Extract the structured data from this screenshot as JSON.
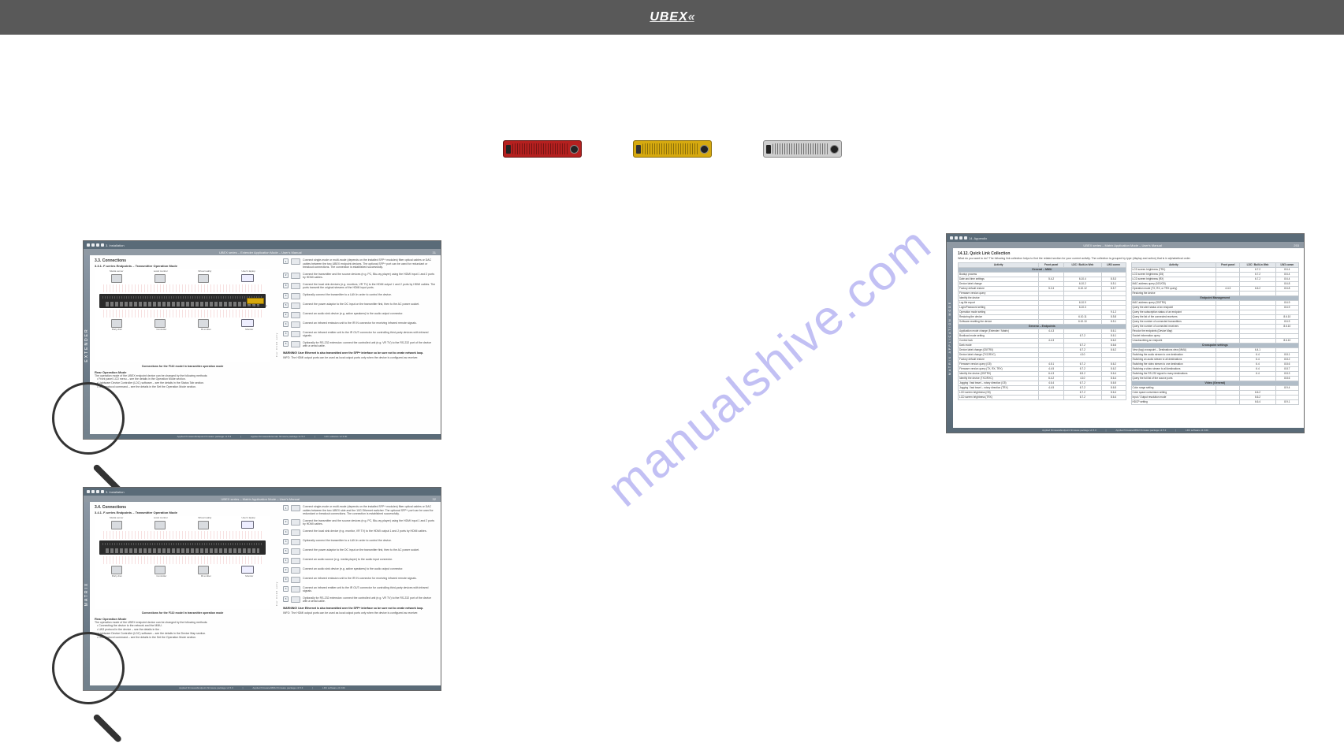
{
  "brand": "UBEX",
  "watermark": "manualshive.com",
  "devices": [
    {
      "name": "device-red",
      "color": "red"
    },
    {
      "name": "device-yellow",
      "color": "yellow"
    },
    {
      "name": "device-silver",
      "color": "silver"
    }
  ],
  "page1": {
    "toolbar_crumb": "3. Installation",
    "header_center": "UBEX series – Extender Application Mode – User's Manual",
    "header_right": "31",
    "sidetab": "EXTENDER",
    "h1": "3.3. Connections",
    "h2": "3.3.1. F-series Endpoints – Transmitter Operation Mode",
    "diag_top": [
      "Media server",
      "Local monitor",
      "Virtual reality",
      "User's laptop"
    ],
    "diag_bottom": [
      "Party disc",
      "Controller",
      "IR emitter",
      "Monitor"
    ],
    "caption": "Connections for the F110 model in transmitter operation mode",
    "sub": "Rear Operation Mode",
    "sub2": "The operation mode of the UBEX endpoint device can be changed by the following methods:",
    "li1": "Front panel LCD menu – see the details in the Operation Mode section.",
    "li2": "Lightware Device Controller (LDC) software – see the details in the Status Tab section.",
    "li3": "LW3 protocol command – see the details in the Set the Operation Mode section.",
    "warn": "WARNING! User Ethernet is also transmitted over the SFP+ interface so be sure not to create network loop.",
    "info": "INFO: The HDMI output ports can be used as local output ports only when the device is configured as receiver.",
    "right_caption": "For F110 only",
    "right_caption2": "For all F-series",
    "steps": [
      "Connect single-mode or multi-mode (depends on the installed SFP+ modules) fiber optical cables or DAC cables between the two UBEX endpoint devices. The optional SFP+ port can be used for redundant or breakout connections. The connection is established successfully.",
      "Connect the transmitter and the source devices (e.g. PC, Blu-ray player) using the HDMI input 1 and 2 ports by HDMI cables.",
      "Connect the local sink devices (e.g. monitors, VR TV) to the HDMI output 1 and 2 ports by HDMI cables. The ports transmit the original streams of the HDMI input ports.",
      "Optionally connect the transmitter to a LAN in order to control the device.",
      "Connect the power adaptor to the DC input on the transmitter first, then to the AC power socket.",
      "",
      "Connect an audio sink device (e.g. active speakers) to the audio output connector.",
      "Connect an infrared emission unit to the IR IN connector for receiving infrared remote signals.",
      "Connect an infrared emitter unit to the IR OUT connector for controlling third-party devices with infrared signals.",
      "Optionally for RS-232 extension: connect the controlled unit (e.g. VR TV) to the RS-232 port of the device with a serial cable."
    ],
    "footer_left": "Applied firmware/Endpoint firmware package v1.5.3",
    "footer_mid": "Applied firmware/Extender firmware package v1.5.3",
    "footer_right": "LDC software v2.3.0b"
  },
  "page2": {
    "toolbar_crumb": "3. Installation",
    "header_center": "UBEX series – Matrix Application Mode – User's Manual",
    "header_right": "32",
    "sidetab": "MATRIX",
    "h1": "3.4. Connections",
    "h2": "3.4.1. F-series Endpoints – Transmitter Operation Mode",
    "diag_top": [
      "Media server",
      "Local monitor",
      "Virtual reality",
      "User's laptop"
    ],
    "diag_bottom": [
      "Party disc",
      "Controller",
      "IR emitter",
      "Monitor"
    ],
    "caption": "Connections for the F110 model in transmitter operation mode",
    "sub": "Rear Operation Mode",
    "sub2": "The operation mode of the UBEX endpoint device can be changed by the following methods:",
    "li1": "Connecting the device to the network and the MMU.",
    "li2": "LW3 protocol in the device – see the details in the .",
    "li3": "Lightware Device Controller (LDC) software – see the details in the Device Map section.",
    "li4": "LW3 protocol command – see the details in the Set the Operation Mode section.",
    "warn": "WARNING! User Ethernet is also transmitted over the SFP+ interface so be sure not to create network loop.",
    "info": "INFO: The HDMI output ports can be used as local output ports only when the device is configured as receiver.",
    "right_caption": "For F110 only",
    "right_caption2": "For all F-series",
    "steps": [
      "Connect single-mode or multi-mode (depends on the installed SFP+ modules) fiber optical cables or DAC cables between the two UBEX side and the 10G Ethernet switcher. The optional SFP+ port can be used for redundant or breakout connections. The connection is established successfully.",
      "Connect the transmitter and the source devices (e.g. PC, Blu-ray player) using the HDMI input 1 and 2 ports by HDMI cables.",
      "Connect the local sink device (e.g. monitor, VR TV) to the HDMI output 1 and 2 ports by HDMI cables.",
      "Optionally connect the transmitter to a LAN in order to control the device.",
      "Connect the power adaptor to the DC input on the transmitter first, then to the AC power socket.",
      "Connect an audio source (e.g. media player) to the audio input connector.",
      "Connect an audio sink device (e.g. active speakers) to the audio output connector.",
      "Connect an infrared emission unit to the IR IN connector for receiving infrared remote signals.",
      "Connect an infrared emitter unit to the IR OUT connector for controlling third-party devices with infrared signals.",
      "Optionally for RS-232 extension: connect the controlled unit (e.g. VR TV) to the RS-232 port of the device with a serial cable."
    ],
    "footer_left": "Applied firmware/Endpoint firmware package v1.5.3",
    "footer_mid": "Applied firmware/MMU firmware package v1.5.3",
    "footer_right": "LDC software v2.3.0b"
  },
  "page3": {
    "toolbar_crumb": "14. Appendix",
    "header_center": "UBEX series – Matrix Application Mode – User's Manual",
    "header_right": "253",
    "sidetab": "MATRIX APPLICATION MODE",
    "h1": "14.12. Quick Link Collection",
    "intro": "What do you want to do? The following link collection helps to find the related section for your current activity. The collection is grouped by type (display and action) that is in alphabetical order.",
    "left_headers": [
      "Activity",
      "Front panel",
      "LDC / Built-in Web",
      "LW3 comm"
    ],
    "right_headers": [
      "Activity",
      "Front panel",
      "LDC / Built-in Web",
      "LW3 comm"
    ],
    "left_group1": "General – MMU",
    "left_group1_rows": [
      [
        "Bootup process",
        "",
        "",
        ""
      ],
      [
        "Date and time settings",
        "5.4.2",
        "6.10.4",
        "8.5.3"
      ],
      [
        "Device label change",
        "",
        "6.10.2",
        "8.5.1"
      ],
      [
        "Factory default restore",
        "5.2.4",
        "6.10.12",
        "8.5.7"
      ],
      [
        "Firmware version query",
        "",
        "",
        ""
      ],
      [
        "Identify the device",
        "",
        "",
        ""
      ],
      [
        "Log file export",
        "",
        "6.10.9",
        ""
      ],
      [
        "Login/Password setting",
        "",
        "6.10.3",
        ""
      ],
      [
        "Operation mode setting",
        "",
        "",
        "9.1.2"
      ],
      [
        "Restoring the device",
        "",
        "6.10.11",
        "8.5.8"
      ],
      [
        "Software resetting the device",
        "",
        "6.10.10",
        "8.5.1"
      ]
    ],
    "left_group2": "General – Endpoints",
    "left_group2_rows": [
      [
        "Application mode change (Extender / Matrix)",
        "4.4.3",
        "",
        "8.6.1"
      ],
      [
        "Bootload mode setting",
        "",
        "6.7.2",
        "8.6.1"
      ],
      [
        "Control lock",
        "4.4.3",
        "",
        "8.6.2"
      ],
      [
        "Dark mode",
        "",
        "6.7.2",
        "8.6.6"
      ],
      [
        "Device label change (G5/TRX)",
        "",
        "6.7.2",
        "8.6.2"
      ],
      [
        "Device label change (TXC/RXC)",
        "",
        "4.10",
        ""
      ],
      [
        "Factory default restore",
        "",
        "",
        ""
      ],
      [
        "Firmware version query (G5)",
        "4.5.1",
        "6.7.2",
        "8.6.2"
      ],
      [
        "Firmware version query (TX, RX, TRX)",
        "4.4.5",
        "6.7.2",
        "8.6.2"
      ],
      [
        "Identify the device (G5/TRX)",
        "6.4.3",
        "6.5.2",
        "8.6.4"
      ],
      [
        "Identify the device (TXC/RXC)",
        "6.4.2",
        "4.10",
        "8.6.4"
      ],
      [
        "Jogging / fast travel – rotary direction (G5)",
        "4.6.4",
        "6.7.2",
        "8.6.5"
      ],
      [
        "Jogging / fast travel – rotary direction (TRX)",
        "4.4.5",
        "6.7.2",
        "8.6.5"
      ],
      [
        "LCD screen brightness (G5)",
        "",
        "6.7.2",
        "8.6.4"
      ],
      [
        "LCD screen brightness (TRX)",
        "",
        "6.7.2",
        "8.6.4"
      ]
    ],
    "right_group1_rows": [
      [
        "LCD screen brightness (TRX)",
        "",
        "6.7.2",
        "8.6.4"
      ],
      [
        "LCD screen brightness (G5)",
        "",
        "6.7.2",
        "8.6.4"
      ],
      [
        "LCD screen brightness (RX)",
        "",
        "6.7.2",
        "8.6.4"
      ],
      [
        "MAC address query (10G/G5)",
        "",
        "",
        "8.6.8"
      ],
      [
        "Operation mode (TX, RX, or TRX query)",
        "4.4.3",
        "6.6.2",
        "8.6.8"
      ],
      [
        "Restoring the device",
        "",
        "",
        ""
      ]
    ],
    "right_group2": "Endpoint Management",
    "right_group2_rows": [
      [
        "MAC address query (G5/TRX)",
        "",
        "",
        "8.6.9"
      ],
      [
        "Query the alert status of an endpoint",
        "",
        "",
        "8.6.9"
      ],
      [
        "Query the subscription status of an endpoint",
        "",
        "",
        ""
      ],
      [
        "Query the list of the connected receivers",
        "",
        "",
        "8.6.10"
      ],
      [
        "Query the number of connected transmitters",
        "",
        "",
        "8.6.9"
      ],
      [
        "Query the number of connected receivers",
        "",
        "",
        "8.6.10"
      ],
      [
        "Recolor the endpoints (Device Map)",
        "",
        "",
        ""
      ],
      [
        "Socket information query",
        "",
        "",
        ""
      ],
      [
        "Unsubscribing an endpoint",
        "",
        "",
        "8.6.10"
      ]
    ],
    "right_group3": "Crosspoint settings",
    "right_group3_rows": [
      [
        "View (tag) crosspoint – Destinations view (MMU)",
        "",
        "6.4.1",
        ""
      ],
      [
        "Switching the audio stream to one destination",
        "",
        "6.4",
        "8.8.1"
      ],
      [
        "Switching an audio stream to all destinations",
        "",
        "6.4",
        "8.8.2"
      ],
      [
        "Switching the video stream to one destination",
        "",
        "6.4",
        "8.8.6"
      ],
      [
        "Switching a video stream to all destinations",
        "",
        "6.4",
        "8.8.7"
      ],
      [
        "Switching the RS-232 signal to many destinations",
        "",
        "6.4",
        "8.8.3"
      ],
      [
        "Query the full list of the source ports",
        "",
        "",
        "8.8.6"
      ]
    ],
    "right_group4": "Video (General)",
    "right_group4_rows": [
      [
        "Color range setting",
        "",
        "",
        "8.9.4"
      ],
      [
        "Color space conversion setting",
        "",
        "6.6.2",
        ""
      ],
      [
        "Input / Output resolution mode",
        "",
        "6.6.2",
        ""
      ],
      [
        "HDCP setting",
        "",
        "6.6.4",
        "8.9.1"
      ]
    ],
    "footer_left": "Applied firmware/Endpoint firmware package v1.5.3",
    "footer_mid": "Applied firmware/MMU firmware package v1.5.3",
    "footer_right": "LDC software v2.3.0b"
  }
}
